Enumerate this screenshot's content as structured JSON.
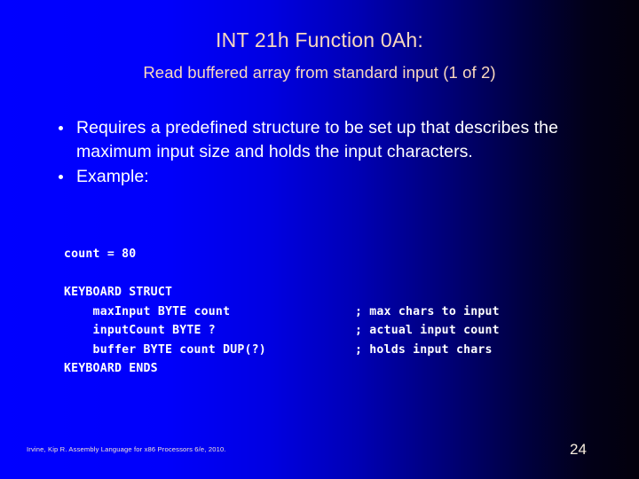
{
  "slide": {
    "title": "INT 21h Function 0Ah:",
    "subtitle": "Read buffered array from standard input (1 of 2)",
    "page_number": "24",
    "citation": "Irvine, Kip R. Assembly Language for x86 Processors 6/e, 2010.",
    "colors": {
      "background_left": "#0000FF",
      "background_right": "#03000C",
      "title_text": "#FAD9BE",
      "body_text": "#FFFFFF",
      "code_text": "#FFFFFF",
      "page_number_text": "#F7ECDD"
    }
  },
  "bullets": [
    {
      "marker": "bullet-dot",
      "text": "Requires a predefined structure to be set up that describes the maximum input size and holds the input characters."
    },
    {
      "marker": "bullet-dot",
      "text": "Example:"
    }
  ],
  "code": {
    "lines": [
      {
        "code": "count = 80",
        "comment": ""
      },
      {
        "code": "",
        "comment": ""
      },
      {
        "code": "KEYBOARD STRUCT",
        "comment": ""
      },
      {
        "code": "    maxInput BYTE count",
        "comment": "; max chars to input"
      },
      {
        "code": "    inputCount BYTE ?",
        "comment": "; actual input count"
      },
      {
        "code": "    buffer BYTE count DUP(?)",
        "comment": "; holds input chars"
      },
      {
        "code": "KEYBOARD ENDS",
        "comment": ""
      }
    ]
  }
}
